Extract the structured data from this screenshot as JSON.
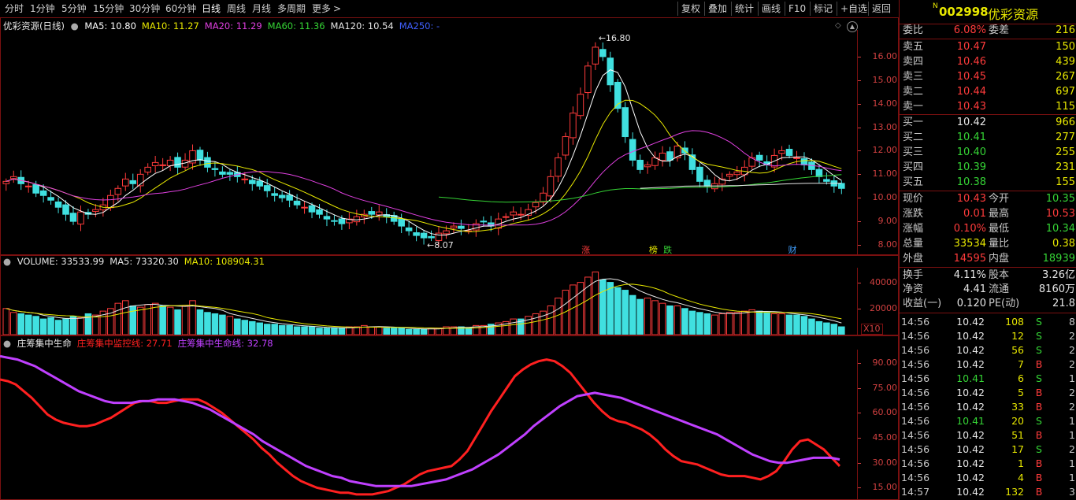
{
  "toolbar": {
    "periods": [
      "分时",
      "1分钟",
      "5分钟",
      "15分钟",
      "30分钟",
      "60分钟",
      "日线",
      "周线",
      "月线",
      "多周期",
      "更多"
    ],
    "active_period": "日线",
    "more_arrow": ">",
    "right_buttons": [
      "复权",
      "叠加",
      "统计",
      "画线",
      "F10",
      "标记",
      "+自选",
      "返回"
    ]
  },
  "main_chart": {
    "legend_name": "优彩资源(日线)",
    "ma": [
      {
        "label": "MA5: 10.80",
        "color": "#ffffff"
      },
      {
        "label": "MA10: 11.27",
        "color": "#e8e800"
      },
      {
        "label": "MA20: 11.29",
        "color": "#e040e0"
      },
      {
        "label": "MA60: 11.36",
        "color": "#35d435"
      },
      {
        "label": "MA120: 10.54",
        "color": "#e6e6e6"
      },
      {
        "label": "MA250: -",
        "color": "#4060ff"
      }
    ],
    "high_marker": "16.80",
    "low_marker": "8.07",
    "event_tags": [
      {
        "text": "涨",
        "color": "#ff3b3b",
        "pos": 0.69
      },
      {
        "text": "榜",
        "color": "#e8e800",
        "pos": 0.77
      },
      {
        "text": "跌",
        "color": "#35d435",
        "pos": 0.787
      },
      {
        "text": "财",
        "color": "#40a0ff",
        "pos": 0.935
      }
    ]
  },
  "volume_chart": {
    "legend": [
      {
        "label": "VOLUME: 33533.99",
        "color": "#e6e6e6"
      },
      {
        "label": "MA5: 73320.30",
        "color": "#e6e6e6"
      },
      {
        "label": "MA10: 108904.31",
        "color": "#e8e800"
      }
    ],
    "unit": "X10"
  },
  "indicator_chart": {
    "legend": [
      {
        "label": "庄筹集中生命",
        "color": "#e6e6e6"
      },
      {
        "label": "庄筹集中监控线: 27.71",
        "color": "#ff2020"
      },
      {
        "label": "庄筹集中生命线: 32.78",
        "color": "#c040ff"
      }
    ]
  },
  "chart_data": [
    {
      "type": "candlestick",
      "title": "优彩资源(日线)",
      "y_ticks": [
        "16.00",
        "15.00",
        "14.00",
        "13.00",
        "12.00",
        "11.00",
        "10.00",
        "9.00",
        "8.00"
      ],
      "ylim": [
        7.8,
        17.0
      ],
      "close_series": [
        10.7,
        10.9,
        10.6,
        10.5,
        10.2,
        10.1,
        9.9,
        9.6,
        9.3,
        9.0,
        9.4,
        9.3,
        9.5,
        9.7,
        10.1,
        10.4,
        10.8,
        10.6,
        11.0,
        11.3,
        11.5,
        11.4,
        11.6,
        11.3,
        11.6,
        12.0,
        11.6,
        11.3,
        11.2,
        11.0,
        11.0,
        10.9,
        10.8,
        10.6,
        10.5,
        10.3,
        10.1,
        10.0,
        9.9,
        9.7,
        9.6,
        9.4,
        9.3,
        9.1,
        9.0,
        8.9,
        9.1,
        9.2,
        9.3,
        9.3,
        9.4,
        9.2,
        9.0,
        8.8,
        8.6,
        8.4,
        8.3,
        8.3,
        8.5,
        8.6,
        8.8,
        8.7,
        8.6,
        8.9,
        9.0,
        8.8,
        9.1,
        9.2,
        9.4,
        9.3,
        9.5,
        9.8,
        10.2,
        10.9,
        11.7,
        12.6,
        13.6,
        14.4,
        15.6,
        16.4,
        16.0,
        14.8,
        13.8,
        12.6,
        11.6,
        11.2,
        11.4,
        11.7,
        11.9,
        11.6,
        12.2,
        11.9,
        11.2,
        10.7,
        10.5,
        10.6,
        10.8,
        11.0,
        11.1,
        11.3,
        11.7,
        11.6,
        11.4,
        11.8,
        12.0,
        11.8,
        11.7,
        11.4,
        11.2,
        10.9,
        10.7,
        10.5,
        10.4
      ],
      "low_price": 8.07,
      "high_price": 16.8
    },
    {
      "type": "bar",
      "title": "VOLUME",
      "y_ticks": [
        "40000",
        "20000"
      ],
      "ylim": [
        0,
        50000
      ],
      "values": [
        20000,
        17000,
        16000,
        15000,
        14000,
        12000,
        13000,
        11000,
        12000,
        14000,
        13000,
        16000,
        15000,
        18000,
        20000,
        24000,
        26000,
        22000,
        21000,
        23000,
        24000,
        22000,
        21000,
        19000,
        22000,
        26000,
        19000,
        17000,
        16000,
        15000,
        14000,
        12000,
        11000,
        10000,
        9000,
        8000,
        8000,
        7000,
        7000,
        6000,
        6000,
        6000,
        5000,
        5000,
        5000,
        5000,
        6000,
        6000,
        7000,
        6000,
        6000,
        5000,
        5000,
        5000,
        4000,
        4000,
        4000,
        5000,
        5000,
        6000,
        6000,
        6000,
        5000,
        7000,
        7000,
        8000,
        9000,
        10000,
        12000,
        12000,
        14000,
        16000,
        18000,
        22000,
        28000,
        34000,
        38000,
        40000,
        44000,
        48000,
        42000,
        40000,
        36000,
        34000,
        30000,
        27000,
        28000,
        26000,
        24000,
        22000,
        22000,
        20000,
        18000,
        17000,
        16000,
        15000,
        16000,
        17000,
        17000,
        18000,
        19000,
        18000,
        17000,
        16000,
        16000,
        15000,
        15000,
        14000,
        12000,
        10000,
        9000,
        8000,
        6000
      ],
      "ma10_value": 108904.31
    },
    {
      "type": "line",
      "title": "庄筹集中生命",
      "y_ticks": [
        "90.00",
        "75.00",
        "60.00",
        "45.00",
        "30.00",
        "15.00"
      ],
      "ylim": [
        10,
        97
      ],
      "series": [
        {
          "name": "庄筹集中监控线",
          "values": [
            80,
            79,
            77,
            73,
            69,
            64,
            59,
            56,
            54,
            53,
            52,
            52,
            53,
            55,
            57,
            60,
            63,
            66,
            67,
            67,
            66,
            66,
            67,
            68,
            68,
            68,
            66,
            63,
            60,
            56,
            52,
            48,
            44,
            39,
            35,
            30,
            26,
            22,
            19,
            17,
            15,
            14,
            13,
            12,
            12,
            11,
            11,
            11,
            12,
            13,
            15,
            17,
            20,
            23,
            25,
            26,
            27,
            28,
            32,
            37,
            45,
            53,
            61,
            68,
            75,
            82,
            86,
            89,
            91,
            92,
            91,
            88,
            84,
            78,
            72,
            66,
            61,
            57,
            55,
            54,
            52,
            50,
            47,
            43,
            38,
            34,
            31,
            30,
            29,
            27,
            25,
            23,
            22,
            22,
            22,
            21,
            20,
            22,
            25,
            31,
            38,
            43,
            44,
            41,
            38,
            33,
            28
          ]
        },
        {
          "name": "庄筹集中生命线",
          "values": [
            94,
            93,
            92,
            90,
            88,
            85,
            82,
            79,
            76,
            73,
            71,
            69,
            67,
            66,
            66,
            66,
            67,
            67,
            68,
            68,
            68,
            67,
            66,
            64,
            62,
            59,
            56,
            53,
            50,
            47,
            43,
            40,
            37,
            34,
            31,
            28,
            26,
            24,
            22,
            21,
            19,
            18,
            17,
            16,
            16,
            16,
            16,
            16,
            17,
            18,
            19,
            20,
            22,
            24,
            26,
            29,
            32,
            35,
            39,
            43,
            47,
            52,
            56,
            60,
            64,
            67,
            70,
            71,
            72,
            71,
            70,
            69,
            67,
            65,
            63,
            61,
            59,
            57,
            55,
            53,
            51,
            49,
            47,
            44,
            41,
            38,
            35,
            33,
            31,
            30,
            30,
            31,
            32,
            33,
            33,
            33,
            32
          ]
        }
      ]
    }
  ],
  "quote": {
    "stock_code": "002998",
    "stock_name": "优彩资源",
    "badge": "N",
    "weibi_label": "委比",
    "weibi_value": "6.08%",
    "weicha_label": "委差",
    "weicha_value": "216",
    "asks": [
      {
        "label": "卖五",
        "price": "10.47",
        "vol": "150",
        "price_color": "#ff3b3b"
      },
      {
        "label": "卖四",
        "price": "10.46",
        "vol": "439",
        "price_color": "#ff3b3b"
      },
      {
        "label": "卖三",
        "price": "10.45",
        "vol": "267",
        "price_color": "#ff3b3b"
      },
      {
        "label": "卖二",
        "price": "10.44",
        "vol": "697",
        "price_color": "#ff3b3b"
      },
      {
        "label": "卖一",
        "price": "10.43",
        "vol": "115",
        "price_color": "#ff3b3b"
      }
    ],
    "bids": [
      {
        "label": "买一",
        "price": "10.42",
        "vol": "966",
        "price_color": "#e6e6e6"
      },
      {
        "label": "买二",
        "price": "10.41",
        "vol": "277",
        "price_color": "#35d435"
      },
      {
        "label": "买三",
        "price": "10.40",
        "vol": "255",
        "price_color": "#35d435"
      },
      {
        "label": "买四",
        "price": "10.39",
        "vol": "231",
        "price_color": "#35d435"
      },
      {
        "label": "买五",
        "price": "10.38",
        "vol": "155",
        "price_color": "#35d435"
      }
    ],
    "stats": [
      {
        "l1": "现价",
        "v1": "10.43",
        "c1": "#ff3b3b",
        "l2": "今开",
        "v2": "10.35",
        "c2": "#35d435"
      },
      {
        "l1": "涨跌",
        "v1": "0.01",
        "c1": "#ff3b3b",
        "l2": "最高",
        "v2": "10.53",
        "c2": "#ff3b3b"
      },
      {
        "l1": "涨幅",
        "v1": "0.10%",
        "c1": "#ff3b3b",
        "l2": "最低",
        "v2": "10.34",
        "c2": "#35d435"
      },
      {
        "l1": "总量",
        "v1": "33534",
        "c1": "#e8e800",
        "l2": "量比",
        "v2": "0.38",
        "c2": "#e8e800"
      },
      {
        "l1": "外盘",
        "v1": "14595",
        "c1": "#ff3b3b",
        "l2": "内盘",
        "v2": "18939",
        "c2": "#35d435"
      }
    ],
    "stats2": [
      {
        "l1": "换手",
        "v1": "4.11%",
        "c1": "#e6e6e6",
        "l2": "股本",
        "v2": "3.26亿",
        "c2": "#e6e6e6"
      },
      {
        "l1": "净资",
        "v1": "4.41",
        "c1": "#e6e6e6",
        "l2": "流通",
        "v2": "8160万",
        "c2": "#e6e6e6"
      },
      {
        "l1": "收益(一)",
        "v1": "0.120",
        "c1": "#e6e6e6",
        "l2": "PE(动)",
        "v2": "21.8",
        "c2": "#e6e6e6"
      }
    ],
    "ticks": [
      {
        "time": "14:56",
        "price": "10.42",
        "price_color": "#e6e6e6",
        "vol": "108",
        "bs": "S",
        "bs_color": "#35d435",
        "n": "8"
      },
      {
        "time": "14:56",
        "price": "10.42",
        "price_color": "#e6e6e6",
        "vol": "12",
        "bs": "S",
        "bs_color": "#35d435",
        "n": "2"
      },
      {
        "time": "14:56",
        "price": "10.42",
        "price_color": "#e6e6e6",
        "vol": "56",
        "bs": "S",
        "bs_color": "#35d435",
        "n": "2"
      },
      {
        "time": "14:56",
        "price": "10.42",
        "price_color": "#e6e6e6",
        "vol": "7",
        "bs": "B",
        "bs_color": "#ff3b3b",
        "n": "2"
      },
      {
        "time": "14:56",
        "price": "10.41",
        "price_color": "#35d435",
        "vol": "6",
        "bs": "S",
        "bs_color": "#35d435",
        "n": "1"
      },
      {
        "time": "14:56",
        "price": "10.42",
        "price_color": "#e6e6e6",
        "vol": "5",
        "bs": "B",
        "bs_color": "#ff3b3b",
        "n": "2"
      },
      {
        "time": "14:56",
        "price": "10.42",
        "price_color": "#e6e6e6",
        "vol": "33",
        "bs": "B",
        "bs_color": "#ff3b3b",
        "n": "2"
      },
      {
        "time": "14:56",
        "price": "10.41",
        "price_color": "#35d435",
        "vol": "20",
        "bs": "S",
        "bs_color": "#35d435",
        "n": "1"
      },
      {
        "time": "14:56",
        "price": "10.42",
        "price_color": "#e6e6e6",
        "vol": "51",
        "bs": "B",
        "bs_color": "#ff3b3b",
        "n": "1"
      },
      {
        "time": "14:56",
        "price": "10.42",
        "price_color": "#e6e6e6",
        "vol": "17",
        "bs": "S",
        "bs_color": "#35d435",
        "n": "2"
      },
      {
        "time": "14:56",
        "price": "10.42",
        "price_color": "#e6e6e6",
        "vol": "1",
        "bs": "B",
        "bs_color": "#ff3b3b",
        "n": "1"
      },
      {
        "time": "14:56",
        "price": "10.42",
        "price_color": "#e6e6e6",
        "vol": "4",
        "bs": "B",
        "bs_color": "#ff3b3b",
        "n": "1"
      },
      {
        "time": "14:57",
        "price": "10.42",
        "price_color": "#e6e6e6",
        "vol": "132",
        "bs": "B",
        "bs_color": "#ff3b3b",
        "n": "3"
      }
    ]
  }
}
